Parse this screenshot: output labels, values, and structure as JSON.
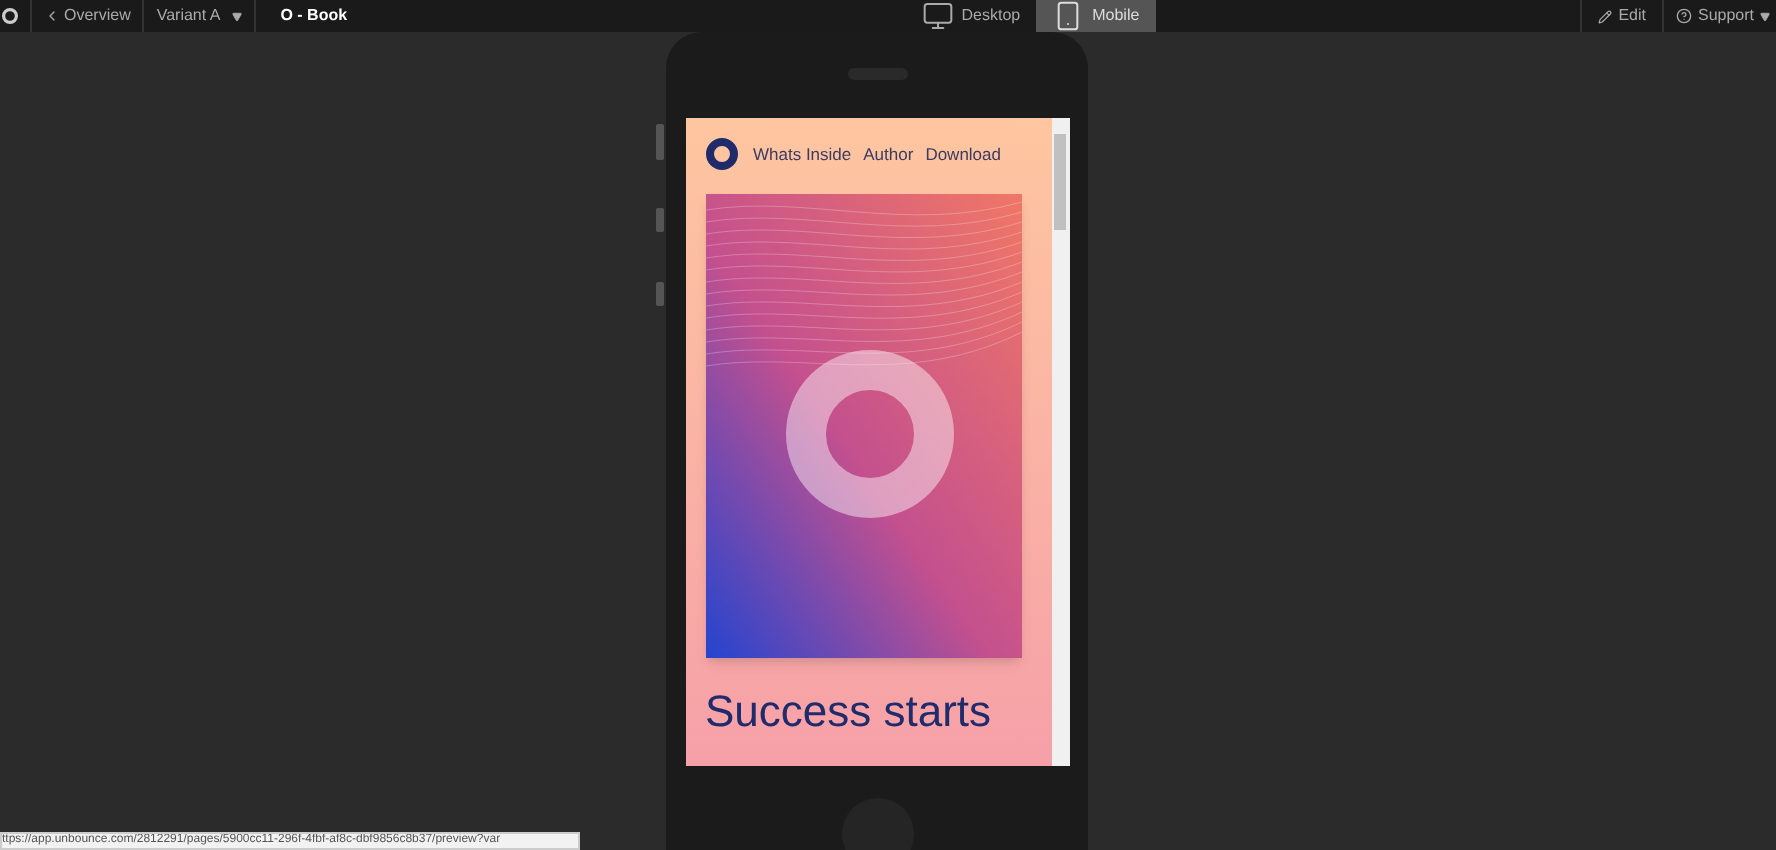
{
  "toolbar": {
    "back": "Overview",
    "variant": "Variant A",
    "page_name": "O - Book",
    "views": [
      {
        "label": "Desktop",
        "kind": "desktop",
        "selected": false
      },
      {
        "label": "Mobile",
        "kind": "mobile",
        "selected": true
      }
    ],
    "edit": "Edit",
    "support": "Support"
  },
  "preview": {
    "nav": [
      "Whats Inside",
      "Author",
      "Download"
    ],
    "headline": "Success starts"
  },
  "status_url": "ttps://app.unbounce.com/2812291/pages/5900cc11-296f-4fbf-af8c-dbf9856c8b37/preview?var"
}
